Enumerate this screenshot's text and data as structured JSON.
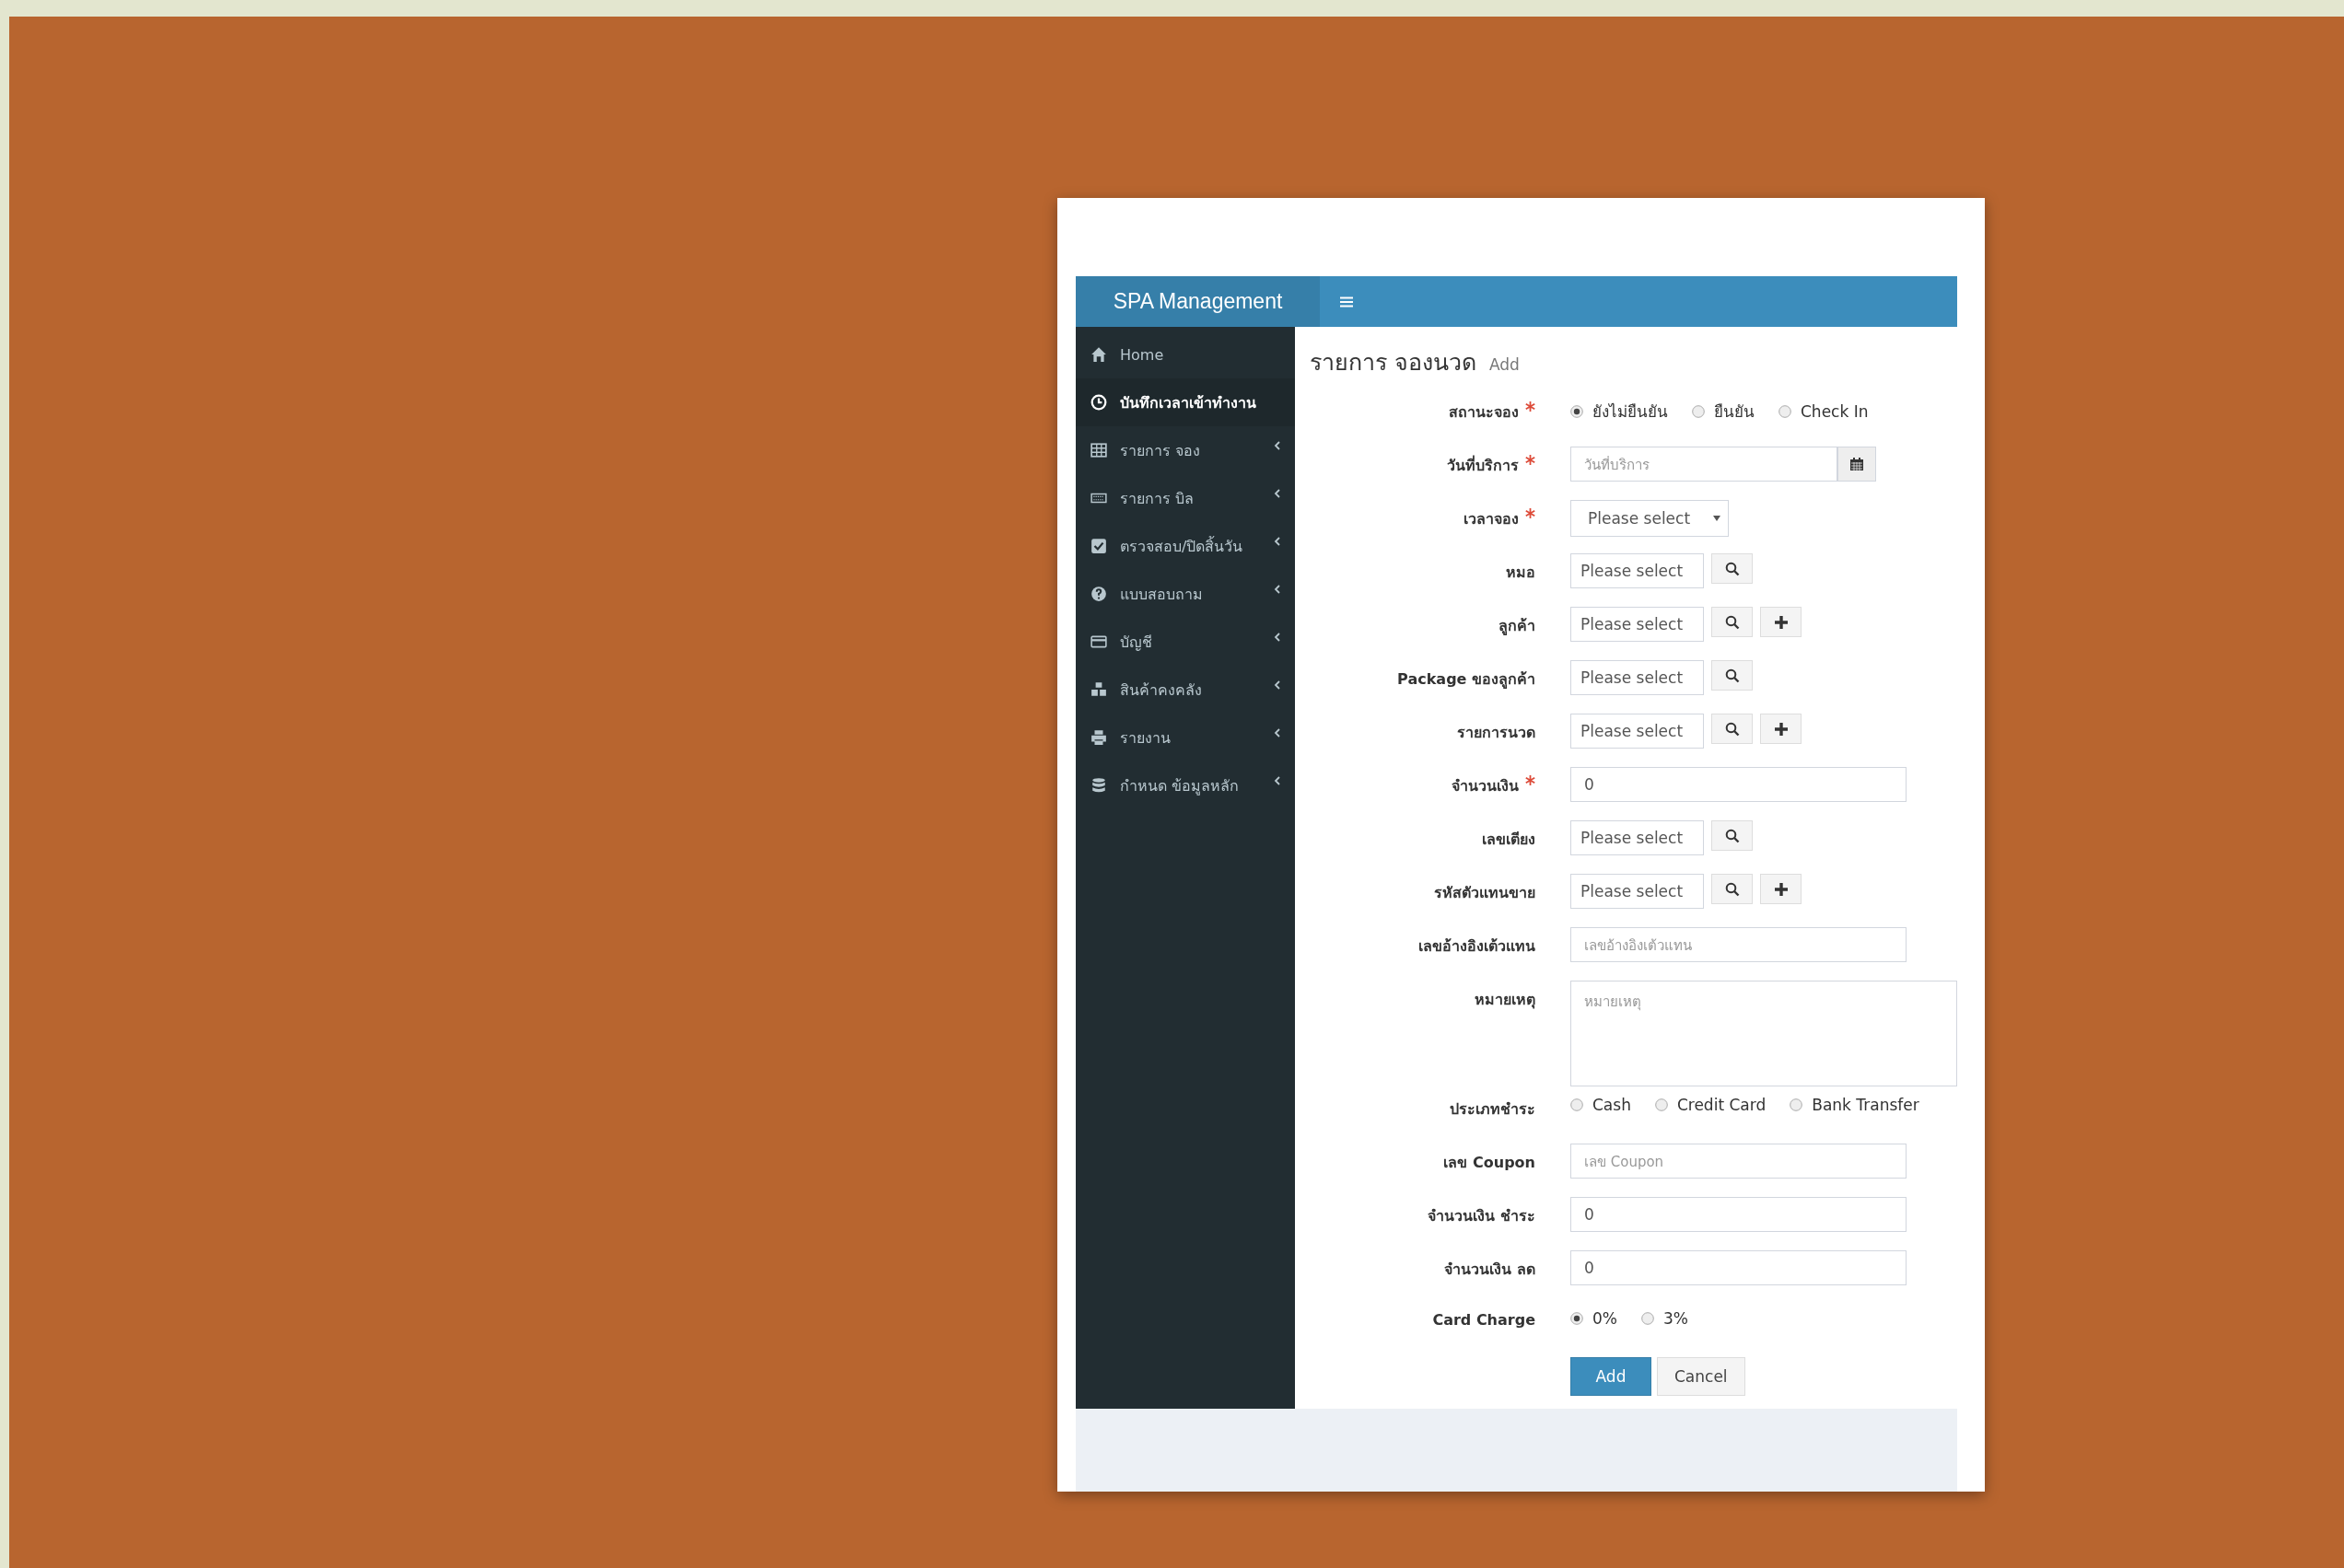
{
  "app": {
    "brand": "SPA Management"
  },
  "sidebar": {
    "items": [
      {
        "label": "Home",
        "selected": false,
        "expandable": false
      },
      {
        "label": "บันทึกเวลาเข้าทำงาน",
        "selected": true,
        "expandable": false
      },
      {
        "label": "รายการ จอง",
        "selected": false,
        "expandable": true
      },
      {
        "label": "รายการ บิล",
        "selected": false,
        "expandable": true
      },
      {
        "label": "ตรวจสอบ/ปิดสิ้นวัน",
        "selected": false,
        "expandable": true
      },
      {
        "label": "แบบสอบถาม",
        "selected": false,
        "expandable": true
      },
      {
        "label": "บัญชี",
        "selected": false,
        "expandable": true
      },
      {
        "label": "สินค้าคงคลัง",
        "selected": false,
        "expandable": true
      },
      {
        "label": "รายงาน",
        "selected": false,
        "expandable": true
      },
      {
        "label": "กำหนด ข้อมูลหลัก",
        "selected": false,
        "expandable": true
      }
    ]
  },
  "page": {
    "title": "รายการ จองนวด",
    "subtitle": "Add"
  },
  "form": {
    "rows": [
      {
        "label": "สถานะจอง",
        "required": true,
        "kind": "radio",
        "options": [
          {
            "label": "ยังไม่ยืนยัน",
            "selected": true
          },
          {
            "label": "ยืนยัน",
            "selected": false
          },
          {
            "label": "Check In",
            "selected": false
          }
        ]
      },
      {
        "label": "วันที่บริการ",
        "required": true,
        "kind": "date",
        "placeholder": "วันที่บริการ"
      },
      {
        "label": "เวลาจอง",
        "required": true,
        "kind": "select",
        "value": "Please select"
      },
      {
        "label": "หมอ",
        "required": false,
        "kind": "picker",
        "value": "Please select",
        "add": false
      },
      {
        "label": "ลูกค้า",
        "required": false,
        "kind": "picker",
        "value": "Please select",
        "add": true
      },
      {
        "label": "Package ของลูกค้า",
        "required": false,
        "kind": "picker",
        "value": "Please select",
        "add": false
      },
      {
        "label": "รายการนวด",
        "required": false,
        "kind": "picker",
        "value": "Please select",
        "add": true
      },
      {
        "label": "จำนวนเงิน",
        "required": true,
        "kind": "text",
        "value": "0"
      },
      {
        "label": "เลขเตียง",
        "required": false,
        "kind": "picker",
        "value": "Please select",
        "add": false
      },
      {
        "label": "รหัสตัวแทนขาย",
        "required": false,
        "kind": "picker",
        "value": "Please select",
        "add": true
      },
      {
        "label": "เลขอ้างอิงเต้วแทน",
        "required": false,
        "kind": "text",
        "placeholder": "เลขอ้างอิงเต้วแทน"
      },
      {
        "label": "หมายเหตุ",
        "required": false,
        "kind": "textarea",
        "placeholder": "หมายเหตุ"
      },
      {
        "label": "ประเภทชำระ",
        "required": false,
        "kind": "radio",
        "options": [
          {
            "label": "Cash",
            "selected": false
          },
          {
            "label": "Credit Card",
            "selected": false
          },
          {
            "label": "Bank Transfer",
            "selected": false
          }
        ]
      },
      {
        "label": "เลข Coupon",
        "required": false,
        "kind": "text",
        "placeholder": "เลข Coupon"
      },
      {
        "label": "จำนวนเงิน ชำระ",
        "required": false,
        "kind": "text",
        "value": "0"
      },
      {
        "label": "จำนวนเงิน ลด",
        "required": false,
        "kind": "text",
        "value": "0"
      },
      {
        "label": "Card Charge",
        "required": false,
        "kind": "radio",
        "options": [
          {
            "label": "0%",
            "selected": true
          },
          {
            "label": "3%",
            "selected": false
          }
        ]
      }
    ],
    "buttons": [
      {
        "label": "Add",
        "kind": "primary"
      },
      {
        "label": "Cancel",
        "kind": "default"
      }
    ]
  }
}
